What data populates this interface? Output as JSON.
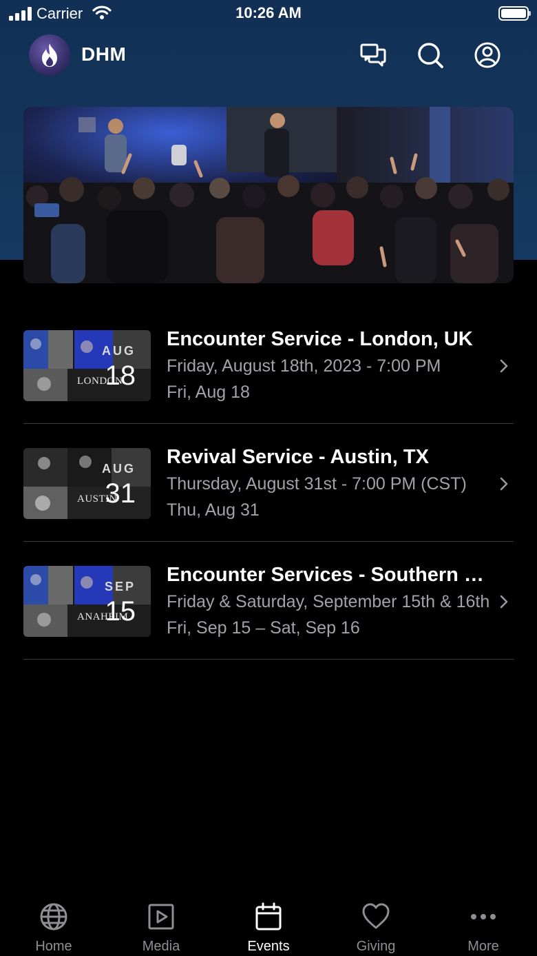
{
  "status_bar": {
    "carrier": "Carrier",
    "time": "10:26 AM"
  },
  "header": {
    "title": "DHM",
    "icons": [
      "chat-icon",
      "search-icon",
      "profile-icon"
    ]
  },
  "events": [
    {
      "title": "Encounter Service - London, UK",
      "subtitle": "Friday, August 18th, 2023 - 7:00 PM",
      "short_date": "Fri, Aug 18",
      "thumb_month": "AUG",
      "thumb_day": "18",
      "thumb_city": "LONDON"
    },
    {
      "title": "Revival Service - Austin, TX",
      "subtitle": "Thursday, August 31st - 7:00 PM (CST)",
      "short_date": "Thu, Aug 31",
      "thumb_month": "AUG",
      "thumb_day": "31",
      "thumb_city": "AUSTIN"
    },
    {
      "title": "Encounter Services - Southern California",
      "subtitle": "Friday & Saturday, September 15th & 16th",
      "short_date": "Fri, Sep 15 – Sat, Sep 16",
      "thumb_month": "SEP",
      "thumb_day": "15",
      "thumb_city": "ANAHEIM"
    }
  ],
  "tabs": [
    {
      "label": "Home",
      "icon": "globe-icon"
    },
    {
      "label": "Media",
      "icon": "play-icon"
    },
    {
      "label": "Events",
      "icon": "calendar-icon",
      "active": true
    },
    {
      "label": "Giving",
      "icon": "heart-icon"
    },
    {
      "label": "More",
      "icon": "ellipsis-icon"
    }
  ],
  "colors": {
    "header_bg": "#123056",
    "background": "#000000",
    "secondary_text": "#a2a2a8",
    "inactive_tab": "#8e8e93"
  }
}
